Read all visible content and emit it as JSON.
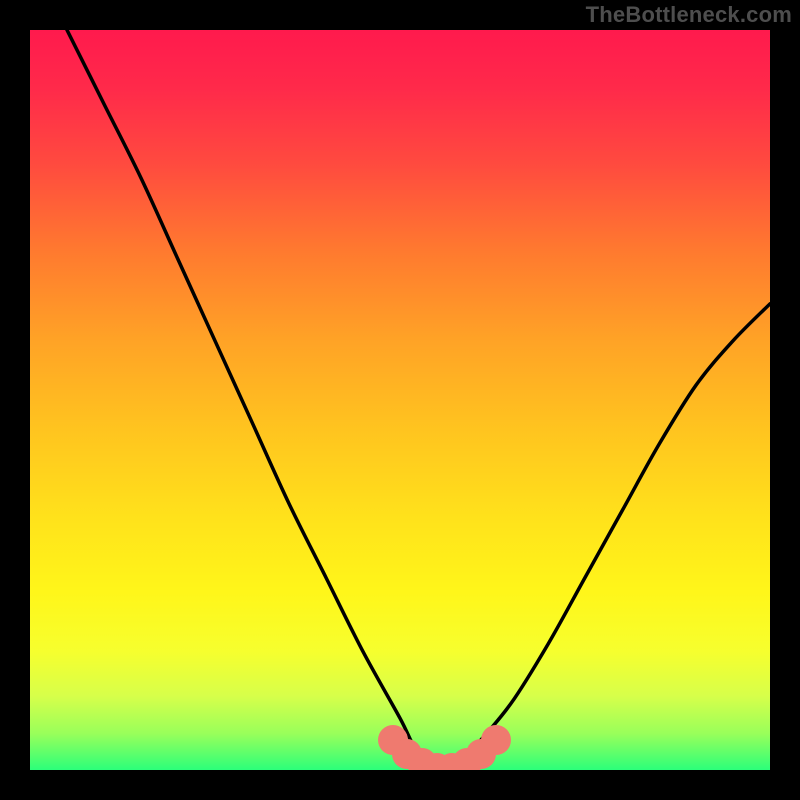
{
  "watermark": "TheBottleneck.com",
  "colors": {
    "frame_bg": "#000000",
    "gradient_top": "#ff1a4d",
    "gradient_bottom": "#2bff7a",
    "curve": "#000000",
    "marker": "#ef7a6f",
    "watermark_text": "#4e4e4e"
  },
  "chart_data": {
    "type": "line",
    "title": "",
    "xlabel": "",
    "ylabel": "",
    "xlim": [
      0,
      100
    ],
    "ylim": [
      0,
      100
    ],
    "grid": false,
    "background": "vertical rainbow gradient (red→yellow→green)",
    "series": [
      {
        "name": "bottleneck-curve",
        "x": [
          5,
          10,
          15,
          20,
          25,
          30,
          35,
          40,
          45,
          50,
          52,
          54,
          56,
          58,
          60,
          65,
          70,
          75,
          80,
          85,
          90,
          95,
          100
        ],
        "y": [
          100,
          90,
          80,
          69,
          58,
          47,
          36,
          26,
          16,
          7,
          3,
          1,
          0,
          1,
          3,
          9,
          17,
          26,
          35,
          44,
          52,
          58,
          63
        ],
        "note": "V-shaped curve; steep left arm starting at top-left, minimum ≈ x=56 y=0, shallower right arm rising to ≈ y=63 at x=100"
      }
    ],
    "annotations": [
      {
        "name": "optimal-range-markers",
        "type": "point-cluster",
        "color": "#ef7a6f",
        "points_x": [
          49,
          51,
          53,
          55,
          57,
          59,
          61,
          63
        ],
        "points_y": [
          4,
          2.2,
          1,
          0.3,
          0.3,
          1,
          2.2,
          4
        ],
        "note": "coral dots hugging the curve bottom, indicating near-zero bottleneck range"
      }
    ]
  }
}
